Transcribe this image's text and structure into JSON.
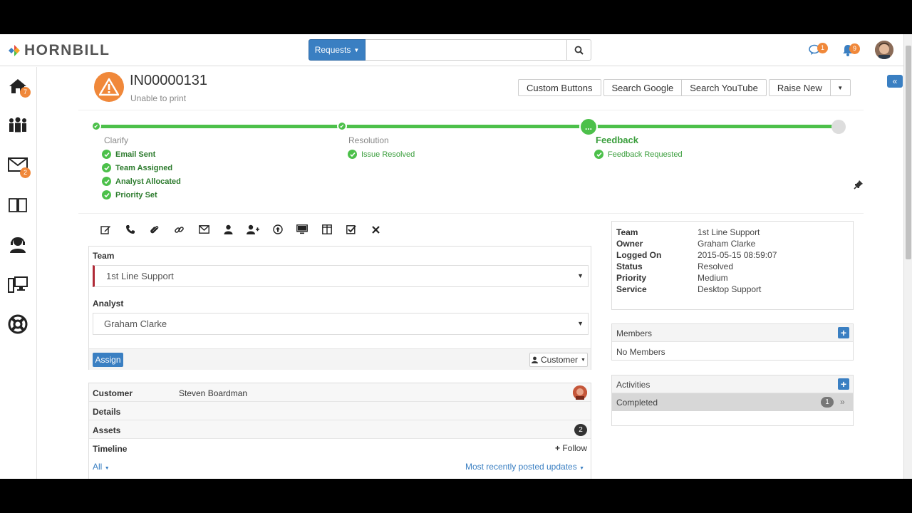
{
  "topbar": {
    "brand": "HORNBILL",
    "requests_label": "Requests",
    "search_placeholder": "",
    "chat_badge": "1",
    "notif_badge": "9"
  },
  "leftnav": {
    "home_badge": "7",
    "mail_badge": "2"
  },
  "request": {
    "ref": "IN00000131",
    "summary": "Unable to print"
  },
  "actions": {
    "custom_buttons": "Custom Buttons",
    "search_google": "Search Google",
    "search_youtube": "Search YouTube",
    "raise_new": "Raise New"
  },
  "progress": {
    "stages": [
      {
        "title": "Clarify",
        "checks": [
          "Email Sent",
          "Team Assigned",
          "Analyst Allocated",
          "Priority Set"
        ]
      },
      {
        "title": "Resolution",
        "checks": [
          "Issue Resolved"
        ]
      },
      {
        "title": "Feedback",
        "checks": [
          "Feedback Requested"
        ]
      }
    ],
    "current_node_label": "..."
  },
  "assign": {
    "team_label": "Team",
    "team_value": "1st Line Support",
    "analyst_label": "Analyst",
    "analyst_value": "Graham Clarke",
    "assign_button": "Assign",
    "customer_button": "Customer"
  },
  "details": {
    "customer_label": "Customer",
    "customer_value": "Steven Boardman",
    "details_label": "Details",
    "assets_label": "Assets",
    "assets_count": "2",
    "timeline_label": "Timeline",
    "follow_label": "Follow",
    "filter_all": "All",
    "filter_sort": "Most recently posted updates"
  },
  "info": [
    {
      "k": "Team",
      "v": "1st Line Support"
    },
    {
      "k": "Owner",
      "v": "Graham Clarke"
    },
    {
      "k": "Logged On",
      "v": "2015-05-15 08:59:07"
    },
    {
      "k": "Status",
      "v": "Resolved"
    },
    {
      "k": "Priority",
      "v": "Medium"
    },
    {
      "k": "Service",
      "v": "Desktop Support"
    }
  ],
  "members": {
    "title": "Members",
    "empty": "No Members"
  },
  "activities": {
    "title": "Activities",
    "completed_label": "Completed",
    "completed_count": "1"
  },
  "colors": {
    "accent": "#3a7fc2",
    "progress": "#4cc04a",
    "warning": "#f0883a",
    "required": "#b02a37"
  }
}
